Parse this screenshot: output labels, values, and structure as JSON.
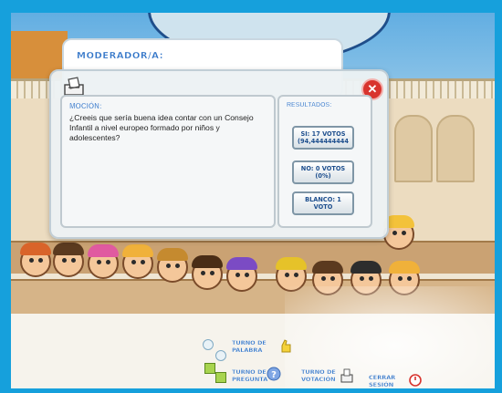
{
  "moderator": {
    "title": "MODERADOR/A:"
  },
  "dialog": {
    "close_glyph": "✕",
    "motion": {
      "label": "MOCIÓN:",
      "text": "¿Creeis que sería buena idea contar con un Consejo Infantil a nivel europeo formado por niños y adolescentes?"
    },
    "results": {
      "label": "RESULTADOS:",
      "si": "SI: 17 VOTOS (94,444444444",
      "no": "NO: 0 VOTOS (0%)",
      "blanco": "BLANCO: 1 VOTO"
    }
  },
  "toolbar": {
    "turno_palabra": "TURNO DE PALABRA",
    "turno_pregunta": "TURNO DE PREGUNTA",
    "turno_votacion": "TURNO DE VOTACIÓN",
    "cerrar_sesion": "CERRAR SESIÓN"
  },
  "icons": [
    "ballot-box-icon",
    "close-icon",
    "thumb-up-icon",
    "question-icon",
    "vote-box-icon",
    "power-icon"
  ],
  "colors": {
    "frame": "#16a0dc",
    "accent_blue": "#2f73c7",
    "close_red": "#d8342e",
    "toolbar_green": "#a8d44f"
  }
}
